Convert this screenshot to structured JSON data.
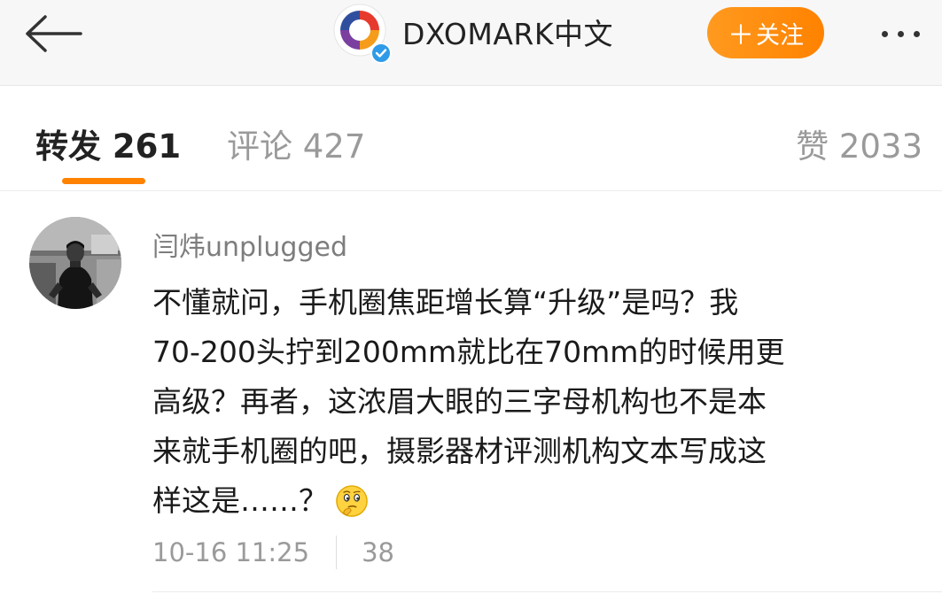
{
  "header": {
    "back_icon": "arrow-left-icon",
    "account_name": "DXOMARK中文",
    "verified_icon": "verified-badge-icon",
    "follow_label": "关注",
    "follow_icon": "plus-icon",
    "more_icon": "more-dots-icon",
    "accent_color": "#ff8200"
  },
  "tabs": {
    "repost": "转发 261",
    "comment": "评论 427",
    "like": "赞 2033",
    "active": "repost"
  },
  "comment": {
    "user_name": "闫炜unplugged",
    "text_lines": [
      "不懂就问，手机圈焦距增长算“升级”是吗？我",
      "70-200头拧到200mm就比在70mm的时候用更",
      "高级？再者，这浓眉大眼的三字母机构也不是本",
      "来就手机圈的吧，摄影器材评测机构文本写成这",
      "样这是……？"
    ],
    "emoji_icon": "thinking-face-emoji-icon",
    "time": "10-16 11:25",
    "likes": "38"
  }
}
